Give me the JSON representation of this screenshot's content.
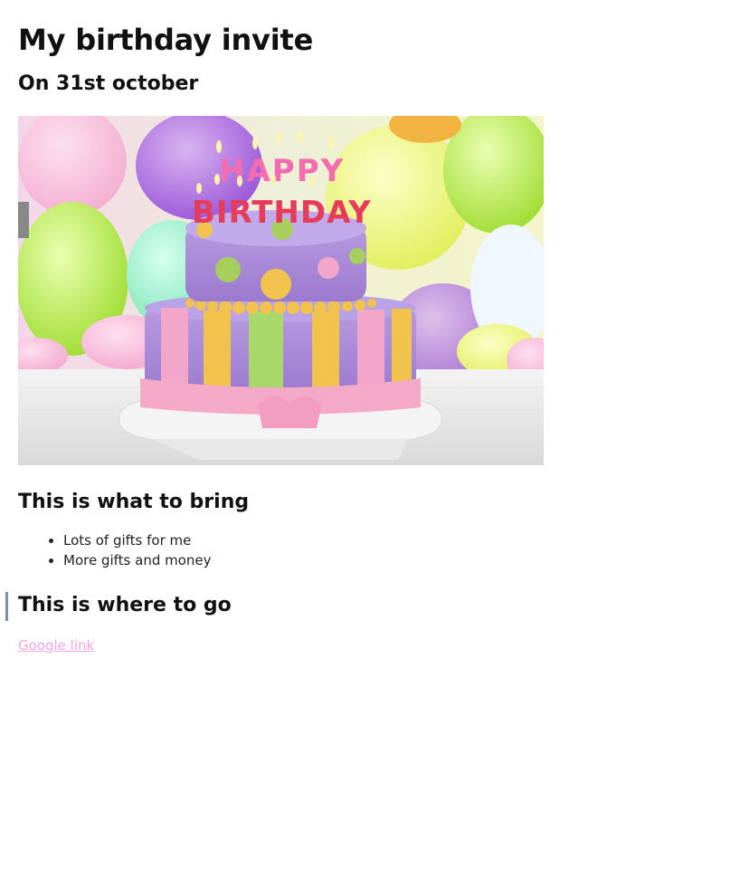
{
  "page": {
    "title": "My birthday invite",
    "date_heading": "On 31st october",
    "hero_image": {
      "alt": "Birthday cake with HAPPY BIRTHDAY candles",
      "candle_text_top": "HAPPY",
      "candle_text_bottom": "BIRTHDAY"
    },
    "bring": {
      "heading": "This is what to bring",
      "items": [
        "Lots of gifts for me",
        "More gifts and money"
      ]
    },
    "where": {
      "heading": "This is where to go",
      "link_text": "Google link"
    }
  },
  "colors": {
    "link": "#f4a4e4",
    "focus_bar": "#7f8db5"
  }
}
